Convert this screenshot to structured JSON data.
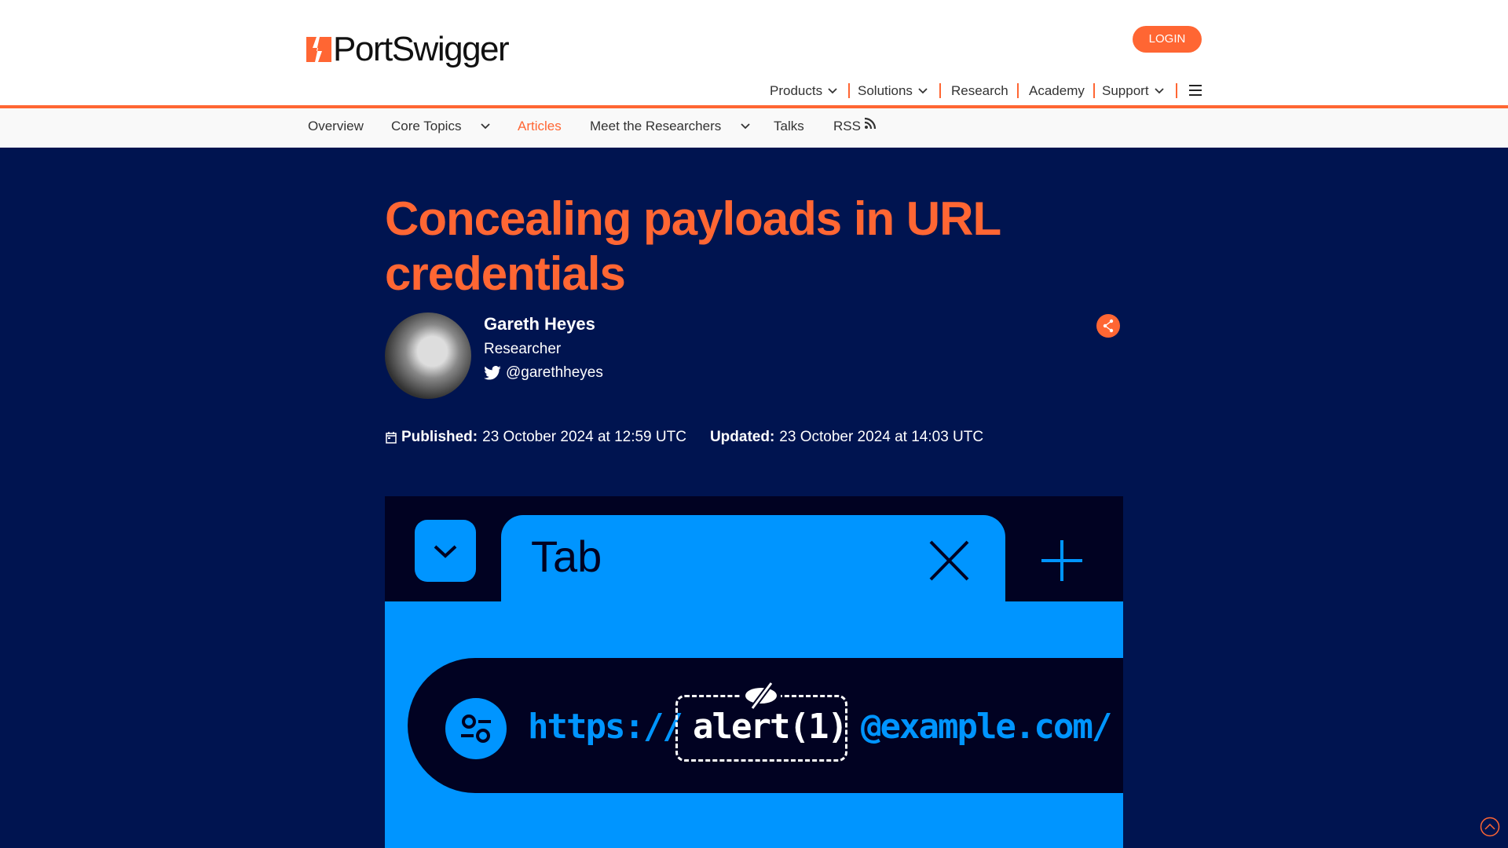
{
  "brand": {
    "name": "PortSwigger"
  },
  "header": {
    "login_label": "LOGIN",
    "nav": [
      {
        "label": "Products"
      },
      {
        "label": "Solutions"
      },
      {
        "label": "Research"
      },
      {
        "label": "Academy"
      },
      {
        "label": "Support"
      }
    ]
  },
  "subnav": {
    "items": [
      {
        "label": "Overview"
      },
      {
        "label": "Core Topics"
      },
      {
        "label": "Articles"
      },
      {
        "label": "Meet the Researchers"
      },
      {
        "label": "Talks"
      },
      {
        "label": "RSS"
      }
    ],
    "active": "Articles"
  },
  "article": {
    "title": "Concealing payloads in URL credentials",
    "author": {
      "name": "Gareth Heyes",
      "role": "Researcher",
      "twitter": "@garethheyes"
    },
    "published_label": "Published:",
    "published": "23 October 2024 at 12:59 UTC",
    "updated_label": "Updated:",
    "updated": "23 October 2024 at 14:03 UTC"
  },
  "hero_image": {
    "tab_label": "Tab",
    "url_scheme": "https://",
    "url_payload": "alert(1)",
    "url_host": "@example.com/"
  },
  "colors": {
    "accent": "#ff6633",
    "hero_bg": "#001450",
    "image_blue": "#0095ff",
    "image_dark": "#010222"
  }
}
